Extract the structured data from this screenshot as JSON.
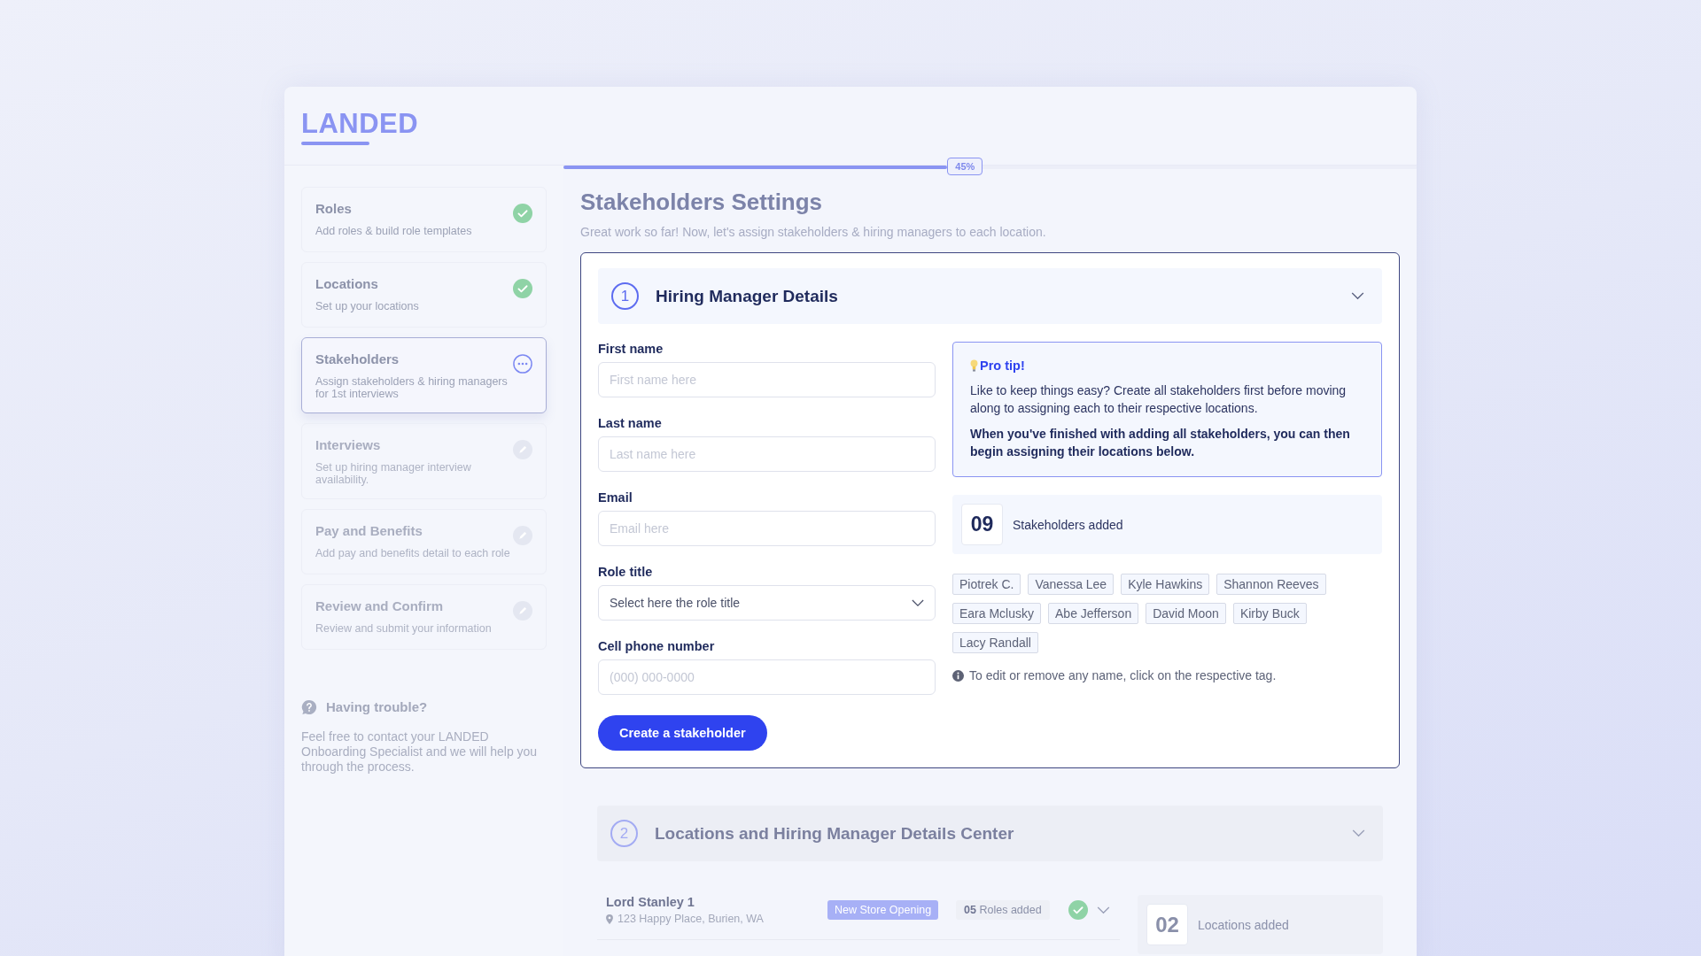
{
  "logo": "LANDED",
  "progress": {
    "level": 0.45,
    "label": "45%"
  },
  "steps": [
    {
      "title": "Roles",
      "description": "Add roles & build role templates",
      "done": true,
      "selected": false,
      "disabled": false
    },
    {
      "title": "Locations",
      "description": "Set up your locations",
      "done": true,
      "selected": false,
      "disabled": false
    },
    {
      "title": "Stakeholders",
      "description": "Assign stakeholders & hiring managers for 1st interviews",
      "done": false,
      "selected": true,
      "disabled": false
    },
    {
      "title": "Interviews",
      "description": "Set up hiring manager interview availability.",
      "done": false,
      "selected": false,
      "disabled": true
    },
    {
      "title": "Pay and Benefits",
      "description": "Add pay and benefits detail to each role",
      "done": false,
      "selected": false,
      "disabled": true
    },
    {
      "title": "Review and Confirm",
      "description": "Review and submit your information",
      "done": false,
      "selected": false,
      "disabled": true
    }
  ],
  "help": {
    "title": "Having trouble?",
    "text": "Feel free to contact your LANDED Onboarding Specialist and we will help you through the process."
  },
  "page": {
    "title": "Stakeholders Settings",
    "subtitle": "Great work so far! Now, let's assign stakeholders & hiring managers to each location."
  },
  "hiring_section": {
    "number": "1",
    "title": "Hiring Manager Details"
  },
  "form": {
    "fields": [
      {
        "label": "First name",
        "placeholder": "First name here",
        "kind": "text"
      },
      {
        "label": "Last name",
        "placeholder": "Last name here",
        "kind": "text"
      },
      {
        "label": "Email",
        "placeholder": "Email here",
        "kind": "text"
      },
      {
        "label": "Role title",
        "placeholder": "Select here the role title",
        "kind": "select"
      },
      {
        "label": "Cell phone number",
        "placeholder": "(000) 000-0000",
        "kind": "text"
      }
    ],
    "submit": "Create a stakeholder"
  },
  "pro_tip": {
    "title": "Pro tip!",
    "text": "Like to keep things easy? Create all stakeholders first before moving along to assigning each to their respective locations.",
    "emphasis": "When you've finished with adding all stakeholders, you can then begin assigning their locations below."
  },
  "stakeholders": {
    "count": "09",
    "label": "Stakeholders added",
    "tags": [
      "Piotrek C.",
      "Vanessa Lee",
      "Kyle Hawkins",
      "Shannon Reeves",
      "Eara Mclusky",
      "Abe Jefferson",
      "David Moon",
      "Kirby Buck",
      "Lacy Randall"
    ],
    "hint": "To edit or remove any name, click on the respective tag."
  },
  "locations_section": {
    "number": "2",
    "title": "Locations and Hiring Manager Details Center",
    "locations": [
      {
        "name": "Lord Stanley 1",
        "address": "123 Happy Place, Burien, WA",
        "tag": "New Store Opening",
        "roles": "**05** Roles added",
        "complete": true
      }
    ],
    "count": "02",
    "count_label": "Locations added"
  }
}
